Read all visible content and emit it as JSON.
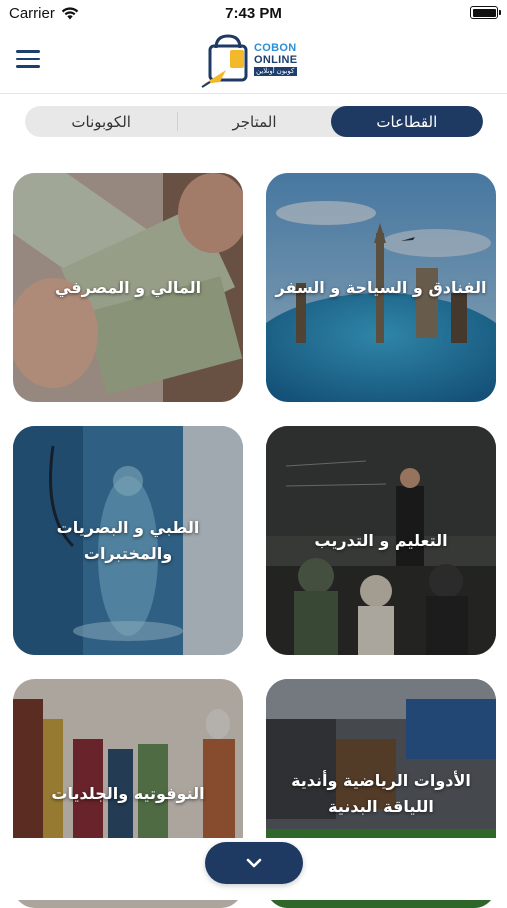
{
  "status_bar": {
    "carrier": "Carrier",
    "time": "7:43 PM"
  },
  "header": {
    "logo_line1": "COBON",
    "logo_line2": "ONLINE",
    "logo_arabic": "كوبون أونلاين"
  },
  "tabs": [
    {
      "label": "القطاعات",
      "active": true
    },
    {
      "label": "المتاجر",
      "active": false
    },
    {
      "label": "الكوبونات",
      "active": false
    }
  ],
  "categories": [
    {
      "label": "الفنادق و السياحة و السفر",
      "image": "travel-globe"
    },
    {
      "label": "المالي و المصرفي",
      "image": "money-cash"
    },
    {
      "label": "التعليم و التدريب",
      "image": "classroom"
    },
    {
      "label": "الطبي و البصريات والمختبرات",
      "image": "medical"
    },
    {
      "label": "الأدوات الرياضية وأندية اللياقة البدنية",
      "image": "sports-store"
    },
    {
      "label": "النوفوتيه والجلديات",
      "image": "clothing-store"
    }
  ],
  "colors": {
    "primary": "#1e3a63",
    "accent": "#2c8fd6",
    "logo_yellow": "#f2b92a"
  }
}
